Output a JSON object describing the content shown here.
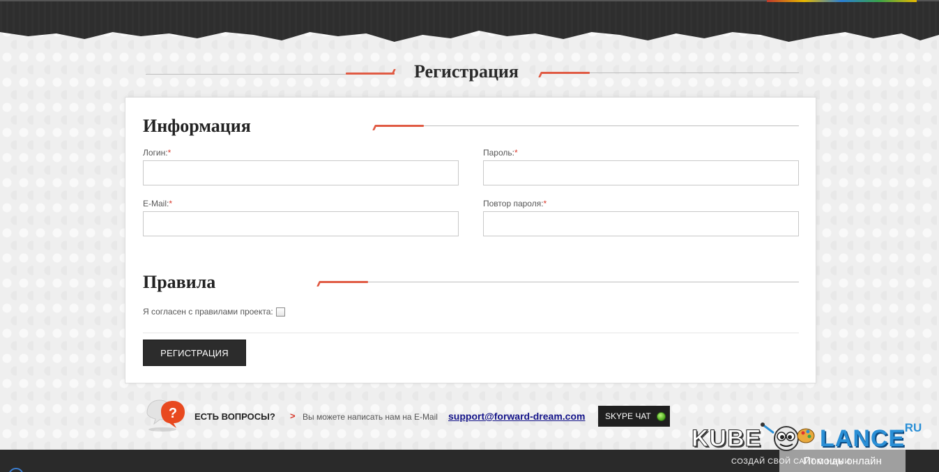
{
  "page": {
    "title": "Регистрация"
  },
  "form": {
    "info_section_title": "Информация",
    "login_label": "Логин:",
    "password_label": "Пароль:",
    "email_label": "E-Mail:",
    "password_repeat_label": "Повтор пароля:",
    "required_mark": "*",
    "login_value": "",
    "password_value": "",
    "email_value": "",
    "password_repeat_value": "",
    "rules_section_title": "Правила",
    "agree_label": "Я согласен с правилами проекта:",
    "agree_checked": false,
    "submit_label": "РЕГИСТРАЦИЯ"
  },
  "help": {
    "question": "ЕСТЬ ВОПРОСЫ?",
    "arrow": ">",
    "text": "Вы можете написать нам на E-Mail",
    "email": "support@forward-dream.com",
    "skype_label": "SKYPE ЧАТ",
    "icon": "question-bubble-icon"
  },
  "watermark": {
    "kube": "KUBE",
    "lance": "LANCE",
    "ru": ".RU",
    "tagline": "СОЗДАЙ СВОЙ САЙТ С НАМИ",
    "online_badge": "Помощь онлайн"
  },
  "colors": {
    "accent": "#e05a43",
    "dark": "#2c2c2c",
    "link": "#14148a",
    "online_green": "#5bb62a"
  }
}
